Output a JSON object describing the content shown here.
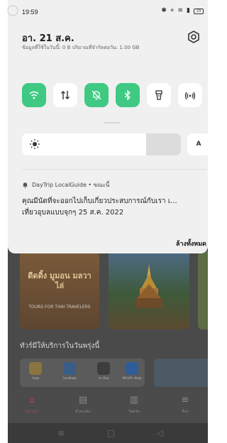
{
  "status_bar": {
    "time": "19:59",
    "battery": "23"
  },
  "shade": {
    "date": "อา. 21 ส.ค.",
    "data_usage": "ข้อมูลที่ใช้ในวันนี้: 0 B ปริมาณที่จำกัดต่อวัน: 1.00 GB",
    "quick_tiles": [
      {
        "name": "wifi",
        "state": "on",
        "icon": "wifi-icon"
      },
      {
        "name": "mobile-data",
        "state": "off",
        "icon": "data-arrows-icon"
      },
      {
        "name": "silent",
        "state": "on",
        "icon": "bell-off-icon"
      },
      {
        "name": "bluetooth",
        "state": "on",
        "icon": "bluetooth-icon"
      },
      {
        "name": "flashlight",
        "state": "off",
        "icon": "flashlight-icon"
      },
      {
        "name": "hotspot",
        "state": "off",
        "icon": "hotspot-icon"
      }
    ],
    "brightness": {
      "level": 0.78,
      "auto_label": "A"
    },
    "accent_on": "#3fc982"
  },
  "notification": {
    "app": "DayTrip LocalGuide • ขณะนี้",
    "line1": "คุณมีนัดที่จะออกไปเก็บเกี่ยวประสบการณ์กับเรา เ...",
    "line2": "เที่ยวอุบลแบบจุกๆ 25 ส.ค. 2022",
    "clear_all": "ล้างทั้งหมด"
  },
  "background_app": {
    "hero_text": "ดีดดิ้ง มูมอน มลวาไล่",
    "hero_sub": "TOURS FOR THAI TRAVELERS",
    "section_title": "ทัวร์มีให้บริการในวันพรุ่งนี้",
    "services": [
      "วันพุธ",
      "โหลดยืนยัน",
      "ข่าวใหม่",
      "วิดีโอรีวิว Keep"
    ],
    "nav": [
      {
        "label": "หน้าหลัก",
        "icon": "home-icon",
        "active": true
      },
      {
        "label": "ตั๋วของฉัน",
        "icon": "ticket-icon",
        "active": false
      },
      {
        "label": "รีพอร์ต",
        "icon": "chart-icon",
        "active": false
      },
      {
        "label": "อื่นๆ",
        "icon": "menu-icon",
        "active": false
      }
    ],
    "system_nav": [
      "≡",
      "□",
      "◁"
    ]
  }
}
